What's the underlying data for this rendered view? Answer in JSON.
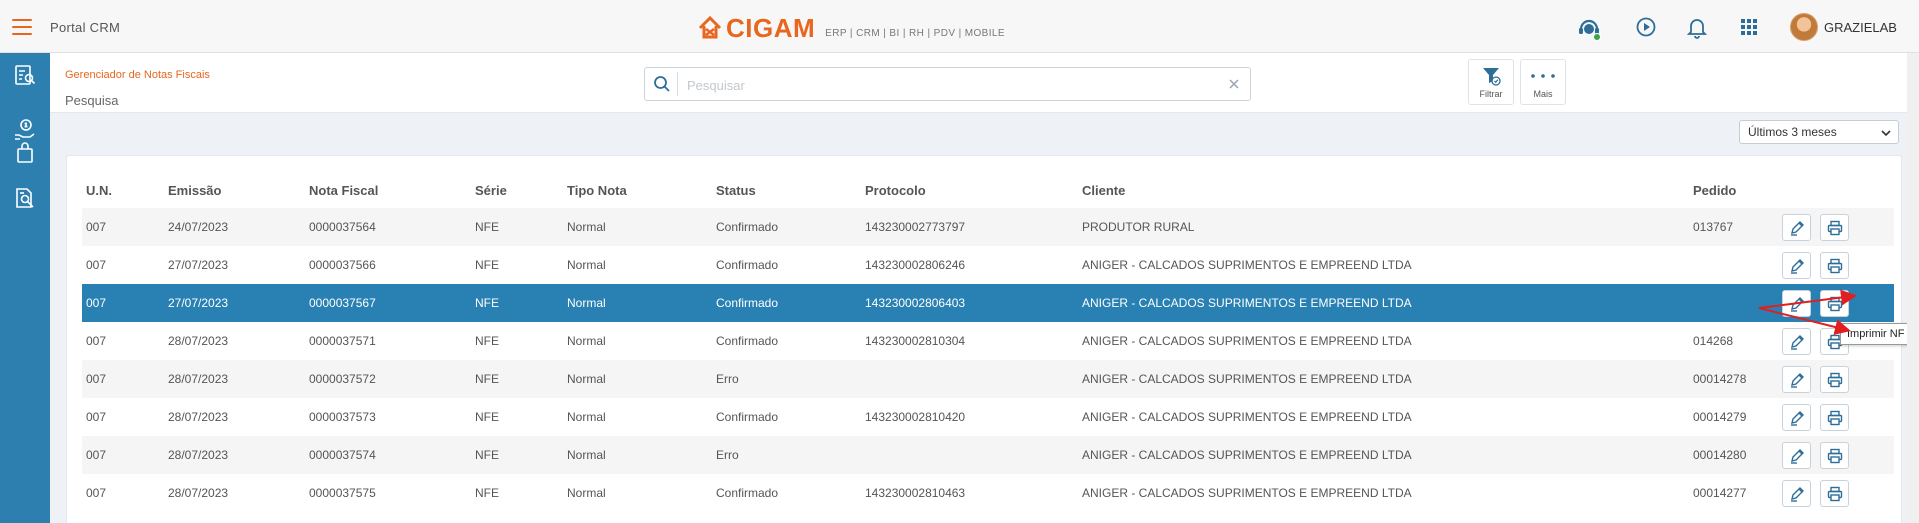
{
  "app": {
    "title": "Portal CRM",
    "logo_text": "CIGAM",
    "logo_subtitle": "ERP | CRM | BI | RH | PDV | MOBILE",
    "username": "GRAZIELAB",
    "accent": "#e8661e",
    "sidebar_color": "#2d7fb0",
    "selected_row_color": "#2980b3"
  },
  "header": {
    "breadcrumb": "Gerenciador de Notas Fiscais",
    "title": "Pesquisa",
    "search_placeholder": "Pesquisar",
    "search_value": "",
    "filter_label": "Filtrar",
    "more_label": "Mais"
  },
  "period_select": {
    "selected": "Últimos 3 meses"
  },
  "table": {
    "columns": [
      "U.N.",
      "Emissão",
      "Nota Fiscal",
      "Série",
      "Tipo Nota",
      "Status",
      "Protocolo",
      "Cliente",
      "Pedido"
    ],
    "rows": [
      [
        "007",
        "24/07/2023",
        "0000037564",
        "NFE",
        "Normal",
        "Confirmado",
        "143230002773797",
        "PRODUTOR RURAL",
        "013767"
      ],
      [
        "007",
        "27/07/2023",
        "0000037566",
        "NFE",
        "Normal",
        "Confirmado",
        "143230002806246",
        "ANIGER - CALCADOS SUPRIMENTOS E EMPREEND LTDA",
        ""
      ],
      [
        "007",
        "27/07/2023",
        "0000037567",
        "NFE",
        "Normal",
        "Confirmado",
        "143230002806403",
        "ANIGER - CALCADOS SUPRIMENTOS E EMPREEND LTDA",
        ""
      ],
      [
        "007",
        "28/07/2023",
        "0000037571",
        "NFE",
        "Normal",
        "Confirmado",
        "143230002810304",
        "ANIGER - CALCADOS SUPRIMENTOS E EMPREEND LTDA",
        "014268"
      ],
      [
        "007",
        "28/07/2023",
        "0000037572",
        "NFE",
        "Normal",
        "Erro",
        "",
        "ANIGER - CALCADOS SUPRIMENTOS E EMPREEND LTDA",
        "00014278"
      ],
      [
        "007",
        "28/07/2023",
        "0000037573",
        "NFE",
        "Normal",
        "Confirmado",
        "143230002810420",
        "ANIGER - CALCADOS SUPRIMENTOS E EMPREEND LTDA",
        "00014279"
      ],
      [
        "007",
        "28/07/2023",
        "0000037574",
        "NFE",
        "Normal",
        "Erro",
        "",
        "ANIGER - CALCADOS SUPRIMENTOS E EMPREEND LTDA",
        "00014280"
      ],
      [
        "007",
        "28/07/2023",
        "0000037575",
        "NFE",
        "Normal",
        "Confirmado",
        "143230002810463",
        "ANIGER - CALCADOS SUPRIMENTOS E EMPREEND LTDA",
        "00014277"
      ]
    ],
    "selected_row": 2,
    "row_actions": [
      "edit-icon",
      "print-icon"
    ]
  },
  "tooltip": {
    "text": "Imprimir NF"
  },
  "icons": {
    "sidebar": [
      "report-search-icon",
      "money-hand-icon",
      "shopping-bag-icon",
      "document-search-icon"
    ],
    "topbar": [
      "support-agent-icon",
      "play-circle-icon",
      "bell-icon",
      "apps-grid-icon"
    ]
  }
}
